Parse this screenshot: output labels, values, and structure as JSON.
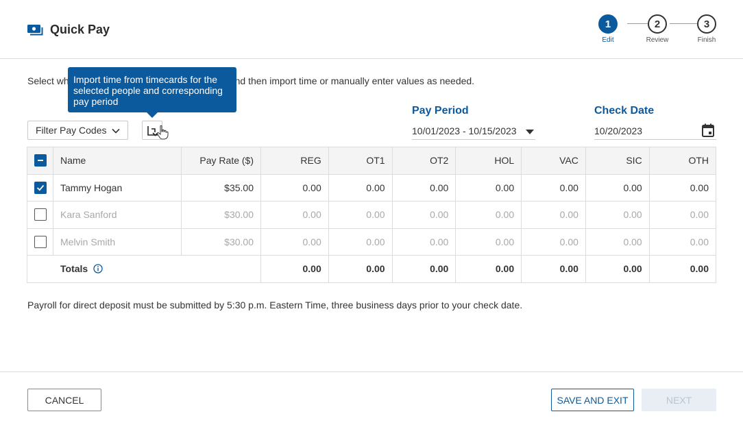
{
  "header": {
    "title": "Quick Pay",
    "icon": "cash-icon",
    "steps": [
      {
        "number": "1",
        "label": "Edit",
        "active": true
      },
      {
        "number": "2",
        "label": "Review",
        "active": false
      },
      {
        "number": "3",
        "label": "Finish",
        "active": false
      }
    ]
  },
  "instructions": {
    "text": "Select wh                                                      run and then import time or manually enter values as needed."
  },
  "tooltip": {
    "text": "Import time from timecards for the selected people and corresponding pay period"
  },
  "filters": {
    "pay_codes_label": "Filter Pay Codes",
    "pay_period_label": "Pay Period",
    "pay_period_value": "10/01/2023 - 10/15/2023",
    "check_date_label": "Check Date",
    "check_date_value": "10/20/2023"
  },
  "table": {
    "headers": [
      "Name",
      "Pay Rate ($)",
      "REG",
      "OT1",
      "OT2",
      "HOL",
      "VAC",
      "SIC",
      "OTH"
    ],
    "rows": [
      {
        "checked": true,
        "name": "Tammy Hogan",
        "rate": "$35.00",
        "values": [
          "0.00",
          "0.00",
          "0.00",
          "0.00",
          "0.00",
          "0.00",
          "0.00"
        ]
      },
      {
        "checked": false,
        "name": "Kara Sanford",
        "rate": "$30.00",
        "values": [
          "0.00",
          "0.00",
          "0.00",
          "0.00",
          "0.00",
          "0.00",
          "0.00"
        ]
      },
      {
        "checked": false,
        "name": "Melvin Smith",
        "rate": "$30.00",
        "values": [
          "0.00",
          "0.00",
          "0.00",
          "0.00",
          "0.00",
          "0.00",
          "0.00"
        ]
      }
    ],
    "totals": {
      "label": "Totals",
      "values": [
        "0.00",
        "0.00",
        "0.00",
        "0.00",
        "0.00",
        "0.00",
        "0.00"
      ]
    }
  },
  "note": "Payroll for direct deposit must be submitted by 5:30 p.m. Eastern Time, three business days prior to your check date.",
  "footer": {
    "cancel": "CANCEL",
    "save_exit": "SAVE AND EXIT",
    "next": "NEXT"
  },
  "colors": {
    "accent": "#0b5a9e",
    "disabled_bg": "#e8eef3",
    "dim_text": "#a8a8a8"
  }
}
